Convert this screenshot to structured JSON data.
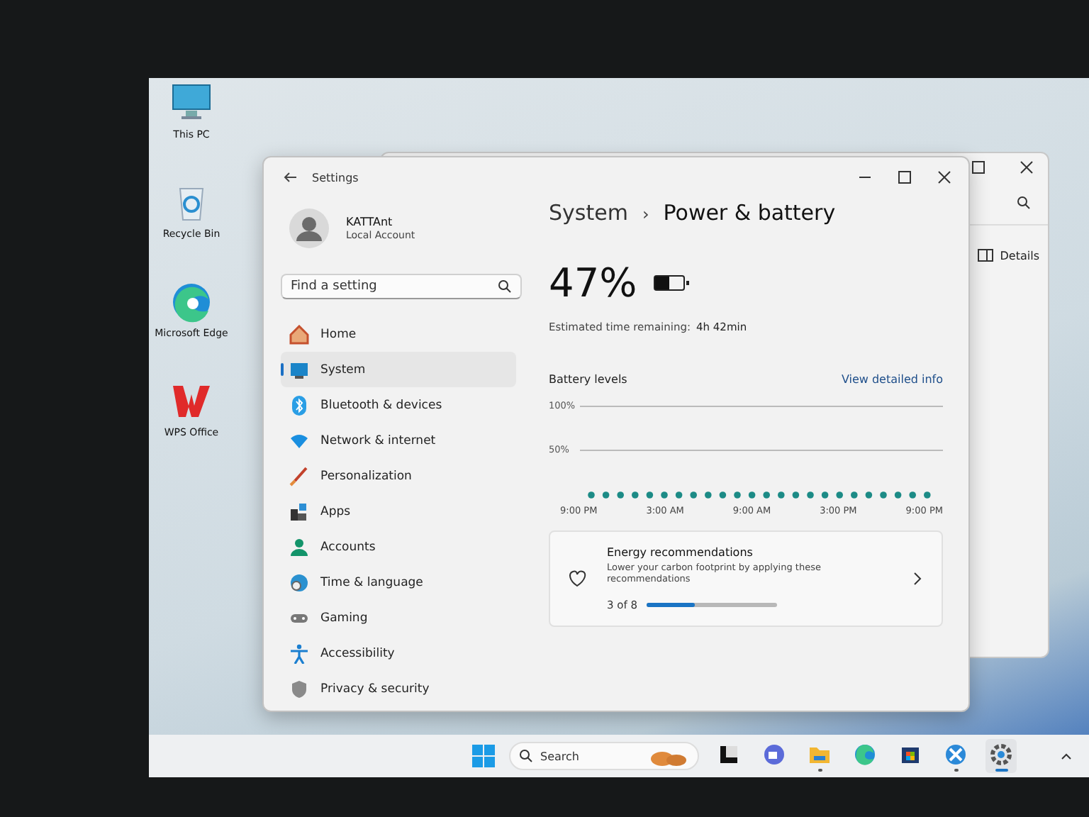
{
  "desktop_icons": [
    {
      "label": "This PC"
    },
    {
      "label": "Recycle Bin"
    },
    {
      "label": "Microsoft Edge"
    },
    {
      "label": "WPS Office"
    }
  ],
  "back_window": {
    "button": "Details"
  },
  "settings": {
    "title": "Settings",
    "user": {
      "name": "KATTAnt",
      "account": "Local Account"
    },
    "search": {
      "placeholder": "Find a setting"
    },
    "nav": [
      {
        "label": "Home",
        "selected": false
      },
      {
        "label": "System",
        "selected": true
      },
      {
        "label": "Bluetooth & devices",
        "selected": false
      },
      {
        "label": "Network & internet",
        "selected": false
      },
      {
        "label": "Personalization",
        "selected": false
      },
      {
        "label": "Apps",
        "selected": false
      },
      {
        "label": "Accounts",
        "selected": false
      },
      {
        "label": "Time & language",
        "selected": false
      },
      {
        "label": "Gaming",
        "selected": false
      },
      {
        "label": "Accessibility",
        "selected": false
      },
      {
        "label": "Privacy & security",
        "selected": false
      }
    ],
    "breadcrumb": {
      "parent": "System",
      "separator": "›",
      "current": "Power & battery"
    },
    "battery": {
      "percent": "47%",
      "level": 0.47,
      "estimate_label": "Estimated time remaining:",
      "estimate_value": "4h 42min"
    },
    "battery_levels": {
      "title": "Battery levels",
      "link": "View detailed info",
      "y_labels": [
        "100%",
        "50%"
      ],
      "x_labels": [
        "9:00 PM",
        "3:00 AM",
        "9:00 AM",
        "3:00 PM",
        "9:00 PM"
      ]
    },
    "energy": {
      "title": "Energy recommendations",
      "description": "Lower your carbon footprint by applying these recommendations",
      "progress": "3 of 8",
      "level": 0.375
    }
  },
  "taskbar": {
    "search": {
      "placeholder": "Search"
    },
    "apps": [
      {
        "running": false,
        "selected": false
      },
      {
        "running": false,
        "selected": false
      },
      {
        "running": true,
        "selected": false
      },
      {
        "running": false,
        "selected": false
      },
      {
        "running": false,
        "selected": false
      },
      {
        "running": true,
        "selected": false
      },
      {
        "running": true,
        "selected": true
      }
    ]
  }
}
